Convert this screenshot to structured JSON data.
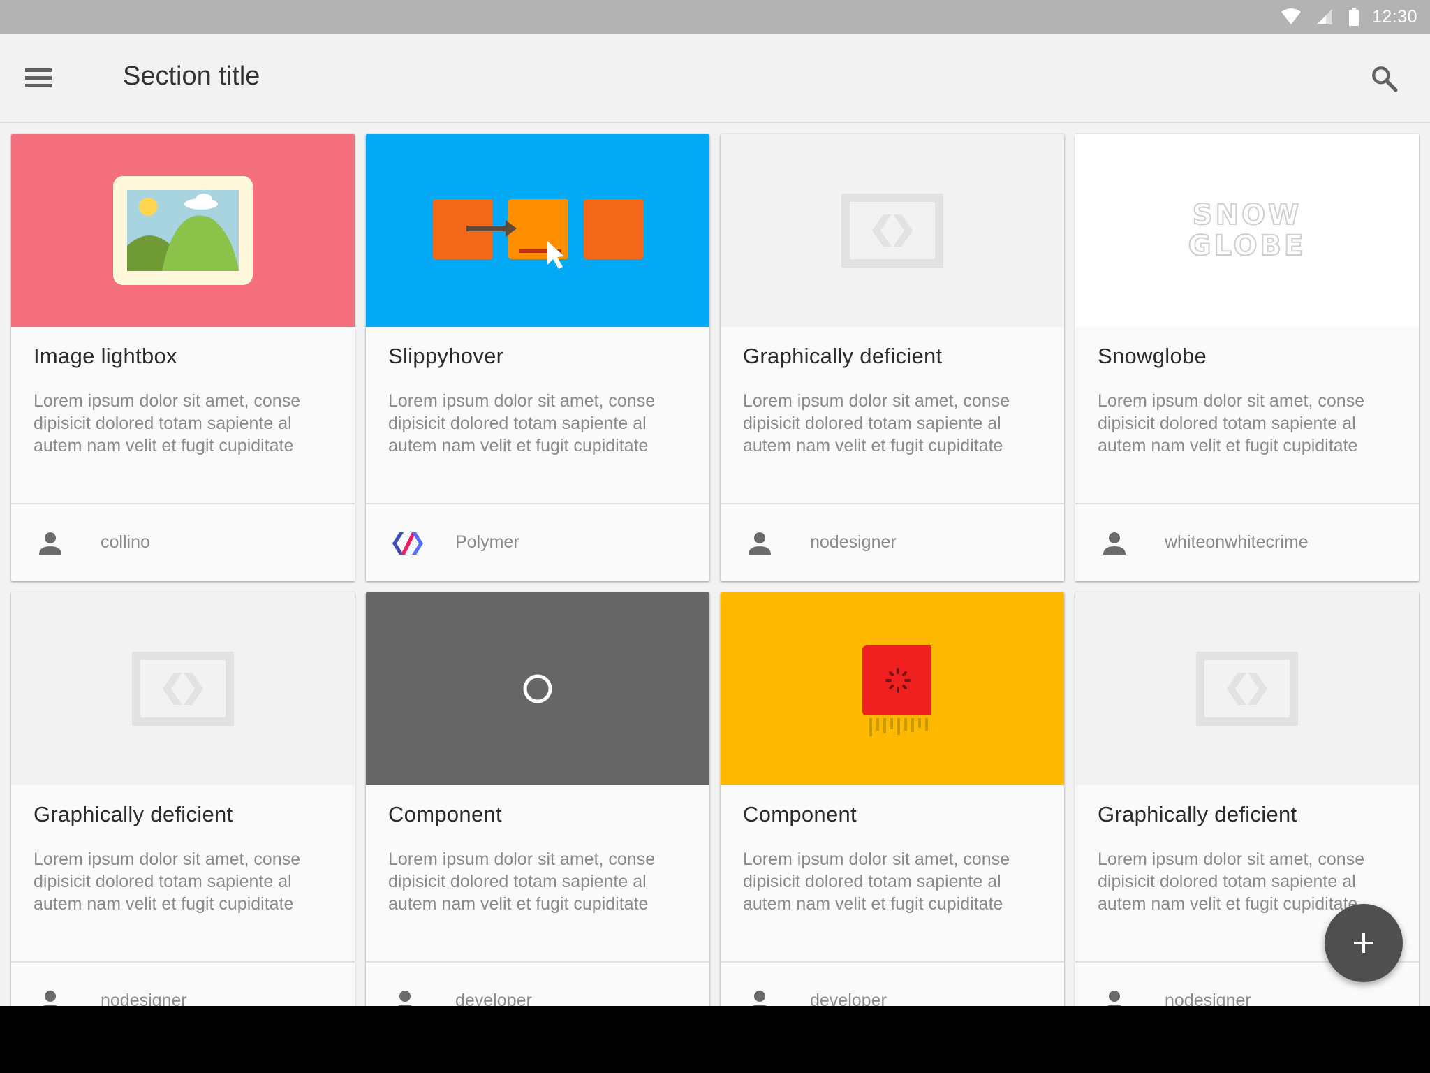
{
  "status_bar": {
    "time": "12:30",
    "icons": [
      "wifi-icon",
      "cell-signal-icon",
      "battery-icon"
    ]
  },
  "toolbar": {
    "title": "Section title",
    "menu_icon": "menu-icon",
    "search_icon": "search-icon"
  },
  "cards": [
    {
      "title": "Image lightbox",
      "description": "Lorem ipsum dolor sit amet, conse dipisicit dolored totam sapiente al autem nam velit et fugit cupiditate",
      "author": "collino",
      "media": "image-lightbox-illustration",
      "media_color": "#f4707e",
      "author_icon": "person-icon"
    },
    {
      "title": "Slippyhover",
      "description": "Lorem ipsum dolor sit amet, conse dipisicit dolored totam sapiente al autem nam velit et fugit cupiditate",
      "author": "Polymer",
      "media": "slippyhover-illustration",
      "media_color": "#03a9f4",
      "author_icon": "polymer-logo-icon"
    },
    {
      "title": "Graphically deficient",
      "description": "Lorem ipsum dolor sit amet, conse dipisicit dolored totam sapiente al autem nam velit et fugit cupiditate",
      "author": "nodesigner",
      "media": "placeholder-logo",
      "media_color": "#f2f2f2",
      "author_icon": "person-icon"
    },
    {
      "title": "Snowglobe",
      "description": "Lorem ipsum dolor sit amet, conse dipisicit dolored totam sapiente al autem nam velit et fugit cupiditate",
      "author": "whiteonwhitecrime",
      "media": "snowglobe-wordmark",
      "media_text_1": "SNOW",
      "media_text_2": "GLOBE",
      "media_color": "#ffffff",
      "author_icon": "person-icon"
    },
    {
      "title": "Graphically deficient",
      "description": "Lorem ipsum dolor sit amet, conse dipisicit dolored totam sapiente al autem nam velit et fugit cupiditate",
      "author": "nodesigner",
      "media": "placeholder-logo",
      "media_color": "#f2f2f2",
      "author_icon": "person-icon"
    },
    {
      "title": "Component",
      "description": "Lorem ipsum dolor sit amet, conse dipisicit dolored totam sapiente al autem nam velit et fugit cupiditate",
      "author": "developer",
      "media": "ring-illustration",
      "media_color": "#666666",
      "author_icon": "person-icon"
    },
    {
      "title": "Component",
      "description": "Lorem ipsum dolor sit amet, conse dipisicit dolored totam sapiente al autem nam velit et fugit cupiditate",
      "author": "developer",
      "media": "chip-spinner-illustration",
      "media_color": "#ffb900",
      "author_icon": "person-icon"
    },
    {
      "title": "Graphically deficient",
      "description": "Lorem ipsum dolor sit amet, conse dipisicit dolored totam sapiente al autem nam velit et fugit cupiditate",
      "author": "nodesigner",
      "media": "placeholder-logo",
      "media_color": "#f2f2f2",
      "author_icon": "person-icon"
    }
  ],
  "fab": {
    "icon": "add-icon"
  }
}
